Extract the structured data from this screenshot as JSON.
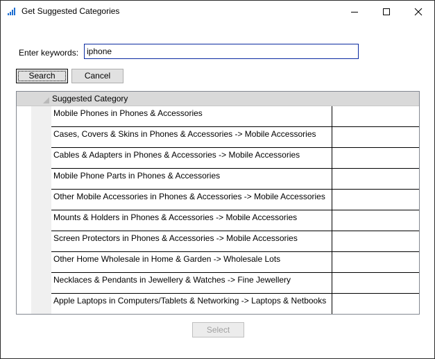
{
  "window": {
    "title": "Get Suggested Categories",
    "icon": "signal-bars-icon",
    "accent_color": "#0a2aa0"
  },
  "search": {
    "label": "Enter keywords:",
    "value": "iphone"
  },
  "buttons": {
    "search": "Search",
    "cancel": "Cancel",
    "select": "Select"
  },
  "grid": {
    "column_header": "Suggested Category",
    "rows": [
      "Mobile Phones in Phones & Accessories",
      "Cases, Covers & Skins in Phones & Accessories -> Mobile Accessories",
      "Cables & Adapters in Phones & Accessories -> Mobile Accessories",
      "Mobile Phone Parts in Phones & Accessories",
      "Other Mobile Accessories in Phones & Accessories -> Mobile Accessories",
      "Mounts & Holders in Phones & Accessories -> Mobile Accessories",
      "Screen Protectors in Phones & Accessories -> Mobile Accessories",
      "Other Home Wholesale in Home & Garden -> Wholesale Lots",
      "Necklaces & Pendants in Jewellery & Watches -> Fine Jewellery",
      "Apple Laptops in Computers/Tablets & Networking -> Laptops & Netbooks"
    ]
  }
}
